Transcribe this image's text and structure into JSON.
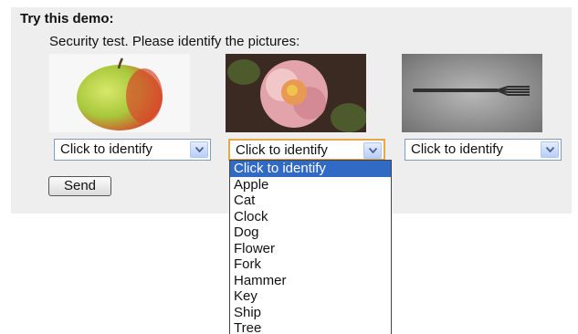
{
  "demo": {
    "title": "Try this demo:",
    "instruction": "Security test. Please identify the pictures:"
  },
  "images": [
    {
      "subject": "apple"
    },
    {
      "subject": "flower"
    },
    {
      "subject": "fork"
    }
  ],
  "selects": [
    {
      "value": "Click to identify"
    },
    {
      "value": "Click to identify"
    },
    {
      "value": "Click to identify"
    }
  ],
  "dropdown": {
    "options": [
      "Click to identify",
      "Apple",
      "Cat",
      "Clock",
      "Dog",
      "Flower",
      "Fork",
      "Hammer",
      "Key",
      "Ship",
      "Tree"
    ],
    "highlighted_index": 0
  },
  "send_button": {
    "label": "Send"
  },
  "colors": {
    "panel": "#eeeeee",
    "highlight": "#316ac5",
    "focus_border": "#e7a64a"
  }
}
